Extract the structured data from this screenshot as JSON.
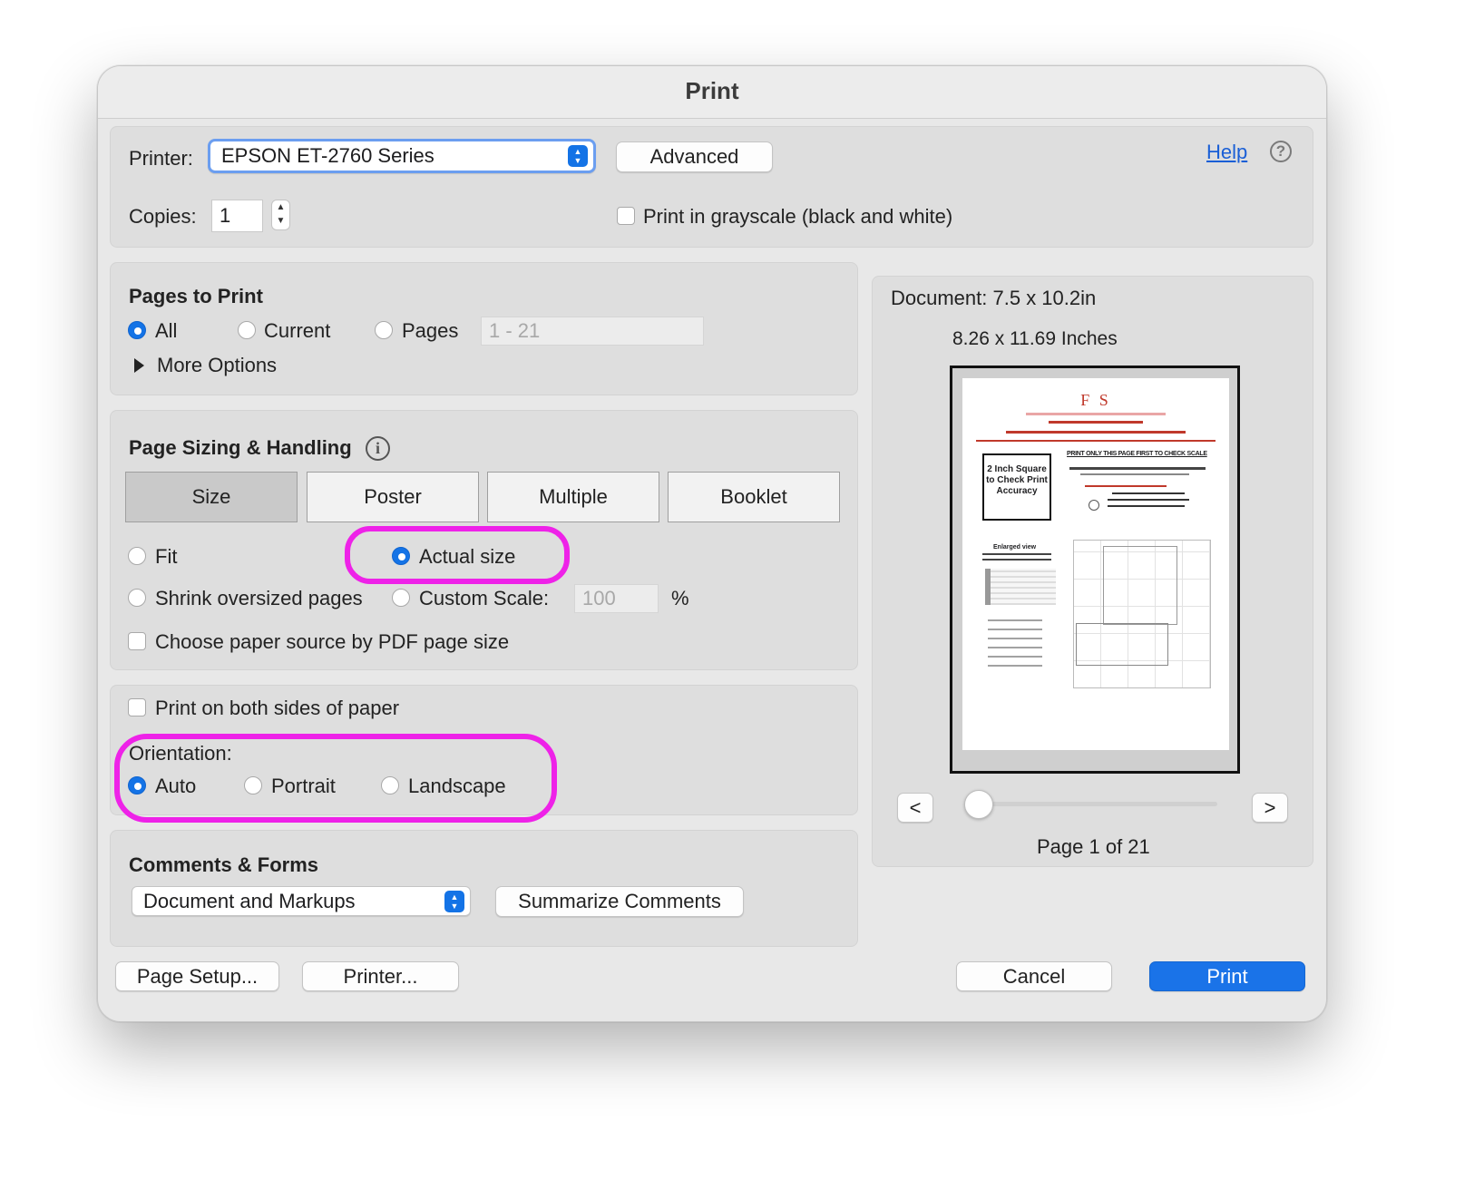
{
  "window": {
    "title": "Print"
  },
  "printer": {
    "label": "Printer:",
    "selected": "EPSON ET-2760 Series",
    "advanced_label": "Advanced",
    "help_label": "Help",
    "copies_label": "Copies:",
    "copies_value": "1",
    "grayscale_label": "Print in grayscale (black and white)"
  },
  "pages_to_print": {
    "heading": "Pages to Print",
    "all_label": "All",
    "current_label": "Current",
    "pages_label": "Pages",
    "range_placeholder": "1 - 21",
    "more_options_label": "More Options",
    "selected": "All"
  },
  "sizing": {
    "heading": "Page Sizing & Handling",
    "tabs": [
      {
        "label": "Size",
        "active": true
      },
      {
        "label": "Poster",
        "active": false
      },
      {
        "label": "Multiple",
        "active": false
      },
      {
        "label": "Booklet",
        "active": false
      }
    ],
    "fit_label": "Fit",
    "actual_size_label": "Actual size",
    "shrink_label": "Shrink oversized pages",
    "custom_scale_label": "Custom Scale:",
    "custom_scale_value": "100",
    "percent_label": "%",
    "paper_source_label": "Choose paper source by PDF page size",
    "selected": "Actual size"
  },
  "duplex": {
    "both_sides_label": "Print on both sides of paper",
    "orientation_label": "Orientation:",
    "auto_label": "Auto",
    "portrait_label": "Portrait",
    "landscape_label": "Landscape",
    "selected": "Auto"
  },
  "comments": {
    "heading": "Comments & Forms",
    "selected": "Document and Markups",
    "summarize_label": "Summarize Comments"
  },
  "preview": {
    "document_size": "Document: 7.5 x 10.2in",
    "paper_size": "8.26 x 11.69 Inches",
    "prev_label": "<",
    "next_label": ">",
    "page_status": "Page 1 of 21",
    "page_text": {
      "logo": "F S",
      "box_text": "2 Inch Square to Check Print Accuracy",
      "heading": "PRINT ONLY THIS PAGE FIRST TO CHECK SCALE",
      "enlarged": "Enlarged view"
    }
  },
  "footer": {
    "page_setup_label": "Page Setup...",
    "printer_label": "Printer...",
    "cancel_label": "Cancel",
    "print_label": "Print"
  },
  "colors": {
    "accent": "#1473e6",
    "highlight": "#ee22e8"
  }
}
